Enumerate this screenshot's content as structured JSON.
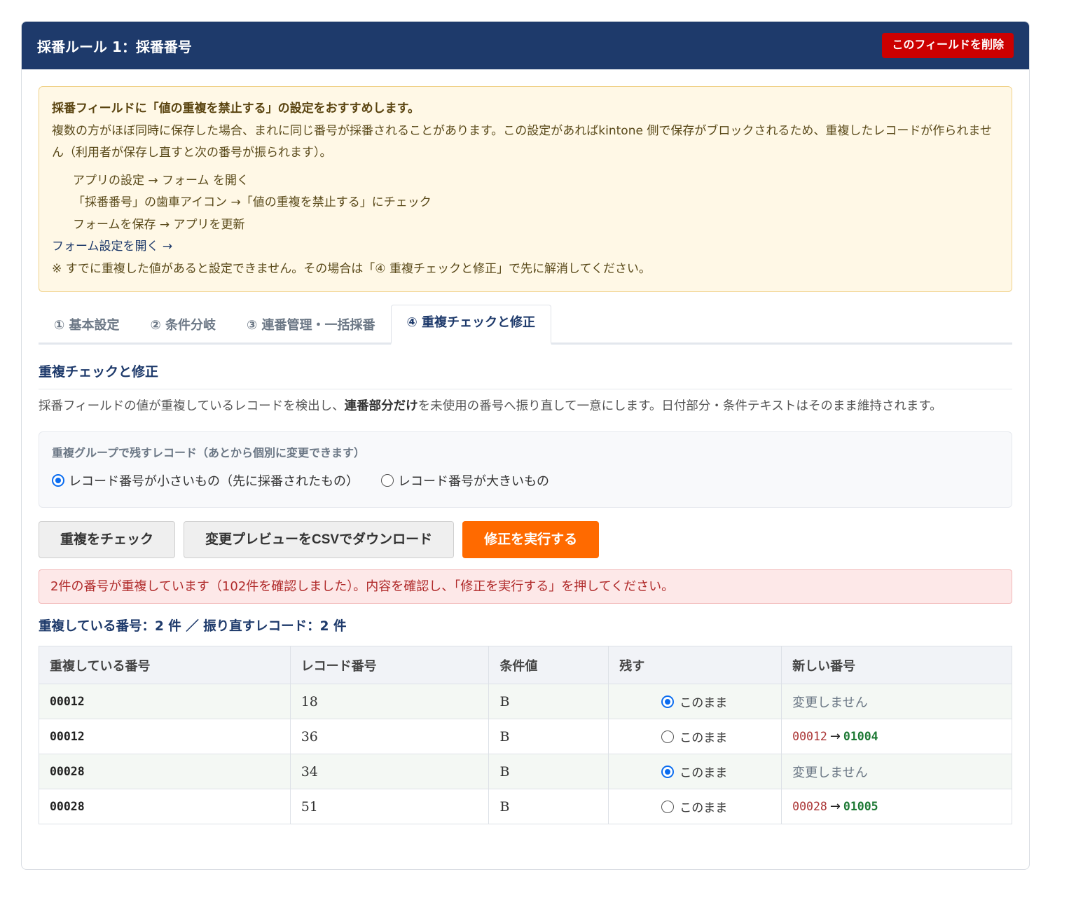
{
  "header": {
    "title": "採番ルール 1：採番番号",
    "delete_label": "このフィールドを削除"
  },
  "notice": {
    "heading": "採番フィールドに「値の重複を禁止する」の設定をおすすめします。",
    "body": "複数の方がほぼ同時に保存した場合、まれに同じ番号が採番されることがあります。この設定があればkintone 側で保存がブロックされるため、重複したレコードが作られません（利用者が保存し直すと次の番号が振られます）。",
    "steps": [
      "アプリの設定 → フォーム を開く",
      "「採番番号」の歯車アイコン →「値の重複を禁止する」にチェック",
      "フォームを保存 → アプリを更新"
    ],
    "link": "フォーム設定を開く →",
    "footnote": "※ すでに重複した値があると設定できません。その場合は「④ 重複チェックと修正」で先に解消してください。"
  },
  "tabs": [
    {
      "label": "① 基本設定",
      "active": false
    },
    {
      "label": "② 条件分岐",
      "active": false
    },
    {
      "label": "③ 連番管理・一括採番",
      "active": false
    },
    {
      "label": "④ 重複チェックと修正",
      "active": true
    }
  ],
  "section": {
    "title": "重複チェックと修正",
    "desc_pre": "採番フィールドの値が重複しているレコードを検出し、",
    "desc_strong": "連番部分だけ",
    "desc_post": "を未使用の番号へ振り直して一意にします。日付部分・条件テキストはそのまま維持されます。"
  },
  "keep_option": {
    "label": "重複グループで残すレコード（あとから個別に変更できます）",
    "options": [
      {
        "label": "レコード番号が小さいもの（先に採番されたもの）",
        "checked": true
      },
      {
        "label": "レコード番号が大きいもの",
        "checked": false
      }
    ]
  },
  "buttons": {
    "check": "重複をチェック",
    "csv": "変更プレビューをCSVでダウンロード",
    "execute": "修正を実行する"
  },
  "alert": "2件の番号が重複しています（102件を確認しました）。内容を確認し、「修正を実行する」を押してください。",
  "summary": "重複している番号：2 件 ／ 振り直すレコード：2 件",
  "table": {
    "headers": [
      "重複している番号",
      "レコード番号",
      "条件値",
      "残す",
      "新しい番号"
    ],
    "keep_label": "このまま",
    "nochange_label": "変更しません",
    "arrow": "→",
    "rows": [
      {
        "dup": "00012",
        "record": "18",
        "cond": "B",
        "keep": true,
        "new_old": "",
        "new_new": ""
      },
      {
        "dup": "00012",
        "record": "36",
        "cond": "B",
        "keep": false,
        "new_old": "00012",
        "new_new": "01004"
      },
      {
        "dup": "00028",
        "record": "34",
        "cond": "B",
        "keep": true,
        "new_old": "",
        "new_new": ""
      },
      {
        "dup": "00028",
        "record": "51",
        "cond": "B",
        "keep": false,
        "new_old": "00028",
        "new_new": "01005"
      }
    ]
  },
  "colors": {
    "header_bg": "#1e3a6b",
    "delete_bg": "#cc0000",
    "execute_bg": "#ff6a00",
    "alert_text": "#b02a2a"
  }
}
